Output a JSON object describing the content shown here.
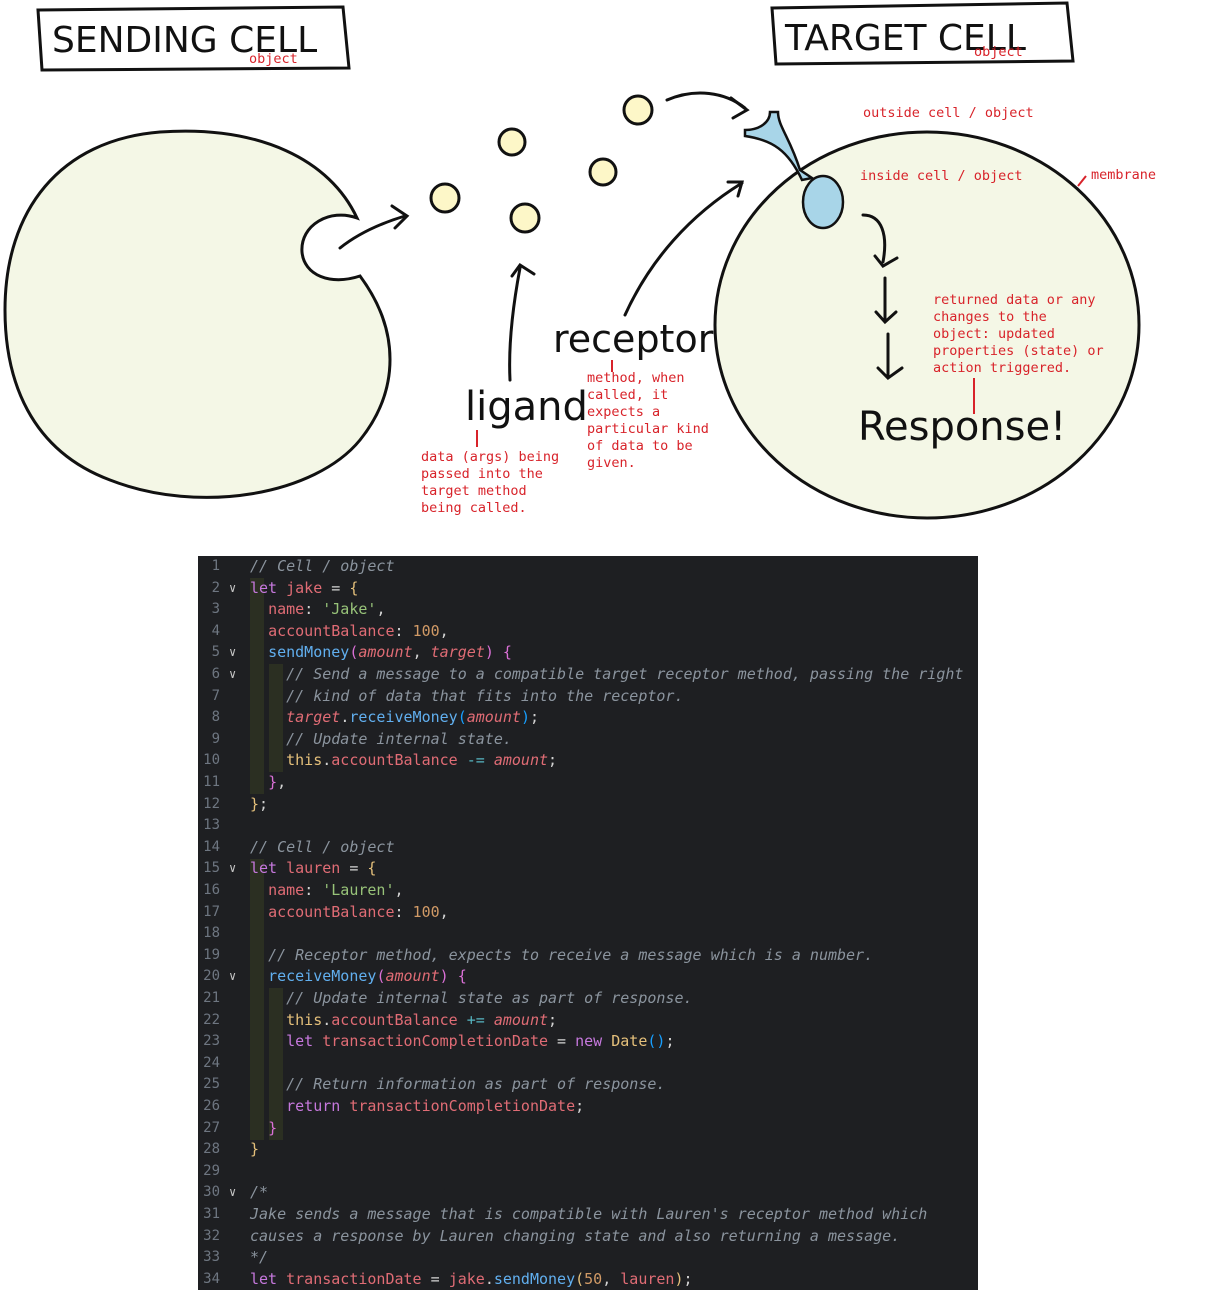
{
  "diagram": {
    "sending_title": "SENDING CELL",
    "sending_sub": "object",
    "target_title": "TARGET CELL",
    "target_sub": "object",
    "outside_label": "outside cell / object",
    "inside_label": "inside cell / object",
    "membrane_label": "membrane",
    "ligand_label": "ligand",
    "receptor_label": "receptor",
    "response_label": "Response!",
    "ligand_note": [
      "data (args) being",
      "passed into the",
      "target method",
      "being called."
    ],
    "receptor_note": [
      "method, when",
      "called, it",
      "expects a",
      "particular kind",
      "of data to be",
      "given."
    ],
    "response_note": [
      "returned data or any",
      "changes to the",
      "object: updated",
      "properties (state) or",
      "action triggered."
    ]
  },
  "code": {
    "lines": [
      {
        "n": "1",
        "fold": "",
        "t": [
          [
            "cm",
            "// Cell / object"
          ]
        ]
      },
      {
        "n": "2",
        "fold": "v",
        "t": [
          [
            "kw",
            "let "
          ],
          [
            "vr",
            "jake "
          ],
          [
            "pl",
            "= "
          ],
          [
            "br1",
            "{"
          ]
        ]
      },
      {
        "n": "3",
        "fold": "",
        "t": [
          [
            "pl",
            "  "
          ],
          [
            "prop",
            "name"
          ],
          [
            "pl",
            ": "
          ],
          [
            "str",
            "'Jake'"
          ],
          [
            "pl",
            ","
          ]
        ]
      },
      {
        "n": "4",
        "fold": "",
        "t": [
          [
            "pl",
            "  "
          ],
          [
            "prop",
            "accountBalance"
          ],
          [
            "pl",
            ": "
          ],
          [
            "num",
            "100"
          ],
          [
            "pl",
            ","
          ]
        ]
      },
      {
        "n": "5",
        "fold": "v",
        "t": [
          [
            "pl",
            "  "
          ],
          [
            "fn",
            "sendMoney"
          ],
          [
            "br2",
            "("
          ],
          [
            "par",
            "amount"
          ],
          [
            "pl",
            ", "
          ],
          [
            "par",
            "target"
          ],
          [
            "br2",
            ")"
          ],
          [
            "pl",
            " "
          ],
          [
            "br2",
            "{"
          ]
        ]
      },
      {
        "n": "6",
        "fold": "v",
        "t": [
          [
            "pl",
            "    "
          ],
          [
            "cm",
            "// Send a message to a compatible target receptor method, passing the right"
          ]
        ]
      },
      {
        "n": "7",
        "fold": "",
        "t": [
          [
            "pl",
            "    "
          ],
          [
            "cm",
            "// kind of data that fits into the receptor."
          ]
        ]
      },
      {
        "n": "8",
        "fold": "",
        "t": [
          [
            "pl",
            "    "
          ],
          [
            "par",
            "target"
          ],
          [
            "pl",
            "."
          ],
          [
            "fn",
            "receiveMoney"
          ],
          [
            "br3",
            "("
          ],
          [
            "par",
            "amount"
          ],
          [
            "br3",
            ")"
          ],
          [
            "pl",
            ";"
          ]
        ]
      },
      {
        "n": "9",
        "fold": "",
        "t": [
          [
            "pl",
            "    "
          ],
          [
            "cm",
            "// Update internal state."
          ]
        ]
      },
      {
        "n": "10",
        "fold": "",
        "t": [
          [
            "pl",
            "    "
          ],
          [
            "cls",
            "this"
          ],
          [
            "pl",
            "."
          ],
          [
            "prop",
            "accountBalance"
          ],
          [
            "pl",
            " "
          ],
          [
            "op",
            "-="
          ],
          [
            "pl",
            " "
          ],
          [
            "par",
            "amount"
          ],
          [
            "pl",
            ";"
          ]
        ]
      },
      {
        "n": "11",
        "fold": "",
        "t": [
          [
            "pl",
            "  "
          ],
          [
            "br2",
            "}"
          ],
          [
            "pl",
            ","
          ]
        ]
      },
      {
        "n": "12",
        "fold": "",
        "t": [
          [
            "br1",
            "}"
          ],
          [
            "pl",
            ";"
          ]
        ]
      },
      {
        "n": "13",
        "fold": "",
        "t": []
      },
      {
        "n": "14",
        "fold": "",
        "t": [
          [
            "cm",
            "// Cell / object"
          ]
        ]
      },
      {
        "n": "15",
        "fold": "v",
        "t": [
          [
            "kw",
            "let "
          ],
          [
            "vr",
            "lauren "
          ],
          [
            "pl",
            "= "
          ],
          [
            "br1",
            "{"
          ]
        ]
      },
      {
        "n": "16",
        "fold": "",
        "t": [
          [
            "pl",
            "  "
          ],
          [
            "prop",
            "name"
          ],
          [
            "pl",
            ": "
          ],
          [
            "str",
            "'Lauren'"
          ],
          [
            "pl",
            ","
          ]
        ]
      },
      {
        "n": "17",
        "fold": "",
        "t": [
          [
            "pl",
            "  "
          ],
          [
            "prop",
            "accountBalance"
          ],
          [
            "pl",
            ": "
          ],
          [
            "num",
            "100"
          ],
          [
            "pl",
            ","
          ]
        ]
      },
      {
        "n": "18",
        "fold": "",
        "t": []
      },
      {
        "n": "19",
        "fold": "",
        "t": [
          [
            "pl",
            "  "
          ],
          [
            "cm",
            "// Receptor method, expects to receive a message which is a number."
          ]
        ]
      },
      {
        "n": "20",
        "fold": "v",
        "t": [
          [
            "pl",
            "  "
          ],
          [
            "fn",
            "receiveMoney"
          ],
          [
            "br2",
            "("
          ],
          [
            "par",
            "amount"
          ],
          [
            "br2",
            ")"
          ],
          [
            "pl",
            " "
          ],
          [
            "br2",
            "{"
          ]
        ]
      },
      {
        "n": "21",
        "fold": "",
        "t": [
          [
            "pl",
            "    "
          ],
          [
            "cm",
            "// Update internal state as part of response."
          ]
        ]
      },
      {
        "n": "22",
        "fold": "",
        "t": [
          [
            "pl",
            "    "
          ],
          [
            "cls",
            "this"
          ],
          [
            "pl",
            "."
          ],
          [
            "prop",
            "accountBalance"
          ],
          [
            "pl",
            " "
          ],
          [
            "op",
            "+="
          ],
          [
            "pl",
            " "
          ],
          [
            "par",
            "amount"
          ],
          [
            "pl",
            ";"
          ]
        ]
      },
      {
        "n": "23",
        "fold": "",
        "t": [
          [
            "pl",
            "    "
          ],
          [
            "kw",
            "let "
          ],
          [
            "vr",
            "transactionCompletionDate"
          ],
          [
            "pl",
            " = "
          ],
          [
            "kw",
            "new "
          ],
          [
            "cls",
            "Date"
          ],
          [
            "br3",
            "()"
          ],
          [
            "pl",
            ";"
          ]
        ]
      },
      {
        "n": "24",
        "fold": "",
        "t": []
      },
      {
        "n": "25",
        "fold": "",
        "t": [
          [
            "pl",
            "    "
          ],
          [
            "cm",
            "// Return information as part of response."
          ]
        ]
      },
      {
        "n": "26",
        "fold": "",
        "t": [
          [
            "pl",
            "    "
          ],
          [
            "kw",
            "return "
          ],
          [
            "vr",
            "transactionCompletionDate"
          ],
          [
            "pl",
            ";"
          ]
        ]
      },
      {
        "n": "27",
        "fold": "",
        "t": [
          [
            "pl",
            "  "
          ],
          [
            "br2",
            "}"
          ]
        ]
      },
      {
        "n": "28",
        "fold": "",
        "t": [
          [
            "br1",
            "}"
          ]
        ]
      },
      {
        "n": "29",
        "fold": "",
        "t": []
      },
      {
        "n": "30",
        "fold": "v",
        "t": [
          [
            "cm",
            "/*"
          ]
        ]
      },
      {
        "n": "31",
        "fold": "",
        "t": [
          [
            "cm",
            "Jake sends a message that is compatible with Lauren's receptor method which"
          ]
        ]
      },
      {
        "n": "32",
        "fold": "",
        "t": [
          [
            "cm",
            "causes a response by Lauren changing state and also returning a message."
          ]
        ]
      },
      {
        "n": "33",
        "fold": "",
        "t": [
          [
            "cm",
            "*/"
          ]
        ]
      },
      {
        "n": "34",
        "fold": "",
        "t": [
          [
            "kw",
            "let "
          ],
          [
            "vr",
            "transactionDate"
          ],
          [
            "pl",
            " = "
          ],
          [
            "vr",
            "jake"
          ],
          [
            "pl",
            "."
          ],
          [
            "fn",
            "sendMoney"
          ],
          [
            "br1",
            "("
          ],
          [
            "num",
            "50"
          ],
          [
            "pl",
            ", "
          ],
          [
            "vr",
            "lauren"
          ],
          [
            "br1",
            ")"
          ],
          [
            "pl",
            ";"
          ]
        ]
      }
    ]
  }
}
